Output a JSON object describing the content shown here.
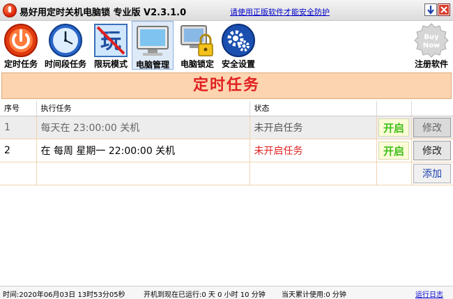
{
  "window": {
    "title": "易好用定时关机电脑锁 专业版 V2.3.1.0",
    "promo_link": "请使用正版软件才能安全防护"
  },
  "toolbar": {
    "items": [
      {
        "label": "定时任务",
        "icon": "power-icon"
      },
      {
        "label": "时间段任务",
        "icon": "clock-icon"
      },
      {
        "label": "限玩模式",
        "icon": "restrict-play-icon"
      },
      {
        "label": "电脑管理",
        "icon": "monitor-icon",
        "active": true
      },
      {
        "label": "电脑锁定",
        "icon": "lock-computer-icon"
      },
      {
        "label": "安全设置",
        "icon": "gear-icon"
      }
    ],
    "register": {
      "label": "注册软件",
      "icon_text_1": "Buy",
      "icon_text_2": "Now"
    }
  },
  "banner": "定时任务",
  "table": {
    "headers": {
      "index": "序号",
      "task": "执行任务",
      "status": "状态"
    },
    "rows": [
      {
        "index": "1",
        "task": "每天在 23:00:00 关机",
        "status": "未开启任务",
        "toggle": "开启",
        "edit": "修改"
      },
      {
        "index": "2",
        "task": "在 每周 星期一 22:00:00 关机",
        "status": "未开启任务",
        "toggle": "开启",
        "edit": "修改"
      }
    ],
    "add_label": "添加"
  },
  "statusbar": {
    "time": "时间:2020年06月03日 13时53分05秒",
    "uptime": "开机到现在已运行:0 天 0 小时 10 分钟",
    "today_usage": "当天累计使用:0 分钟",
    "log_link": "运行日志"
  },
  "colors": {
    "banner_bg": "#fcd5b0",
    "banner_text": "#e02020",
    "toggle_text": "#3fbf1a",
    "status_red": "#e02020",
    "link_blue": "#0000cc"
  }
}
